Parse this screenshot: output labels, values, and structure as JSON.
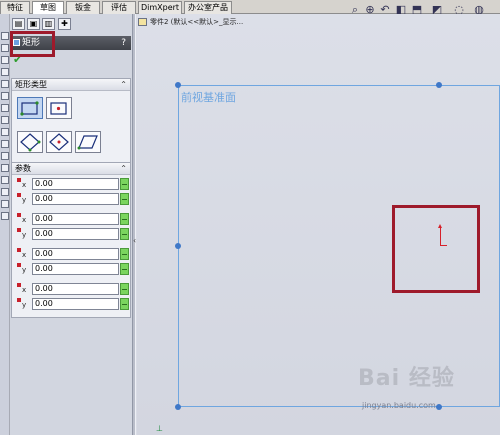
{
  "tabs": [
    {
      "label": "特征"
    },
    {
      "label": "草图"
    },
    {
      "label": "钣金"
    },
    {
      "label": "评估"
    },
    {
      "label": "DimXpert"
    },
    {
      "label": "办公室产品"
    }
  ],
  "active_tab_index": 1,
  "toolbar_icons": [
    "zoom-to-fit-icon",
    "zoom-area-icon",
    "previous-view-icon",
    "section-view-icon",
    "view-orientation-icon",
    "display-style-icon",
    "hide-show-icon",
    "edit-appearance-icon"
  ],
  "feature_tree": {
    "breadcrumb": "零件2 (默认<<默认>_显示..."
  },
  "property_manager": {
    "title": "矩形",
    "help": "?",
    "rect_type_group": {
      "title": "矩形类型"
    },
    "params_group": {
      "title": "参数"
    },
    "params": [
      {
        "axis": "x",
        "value": "0.00"
      },
      {
        "axis": "y",
        "value": "0.00"
      },
      {
        "axis": "x",
        "value": "0.00"
      },
      {
        "axis": "y",
        "value": "0.00"
      },
      {
        "axis": "x",
        "value": "0.00"
      },
      {
        "axis": "y",
        "value": "0.00"
      },
      {
        "axis": "x",
        "value": "0.00"
      },
      {
        "axis": "y",
        "value": "0.00"
      }
    ]
  },
  "canvas": {
    "plane_label": "前视基准面"
  },
  "watermark": {
    "text": "Bai 经验",
    "url": "jingyan.baidu.com"
  },
  "colors": {
    "accent_red": "#9e1a2b",
    "plane_blue": "#6fa6e0",
    "spin_green": "#7bd55f"
  }
}
